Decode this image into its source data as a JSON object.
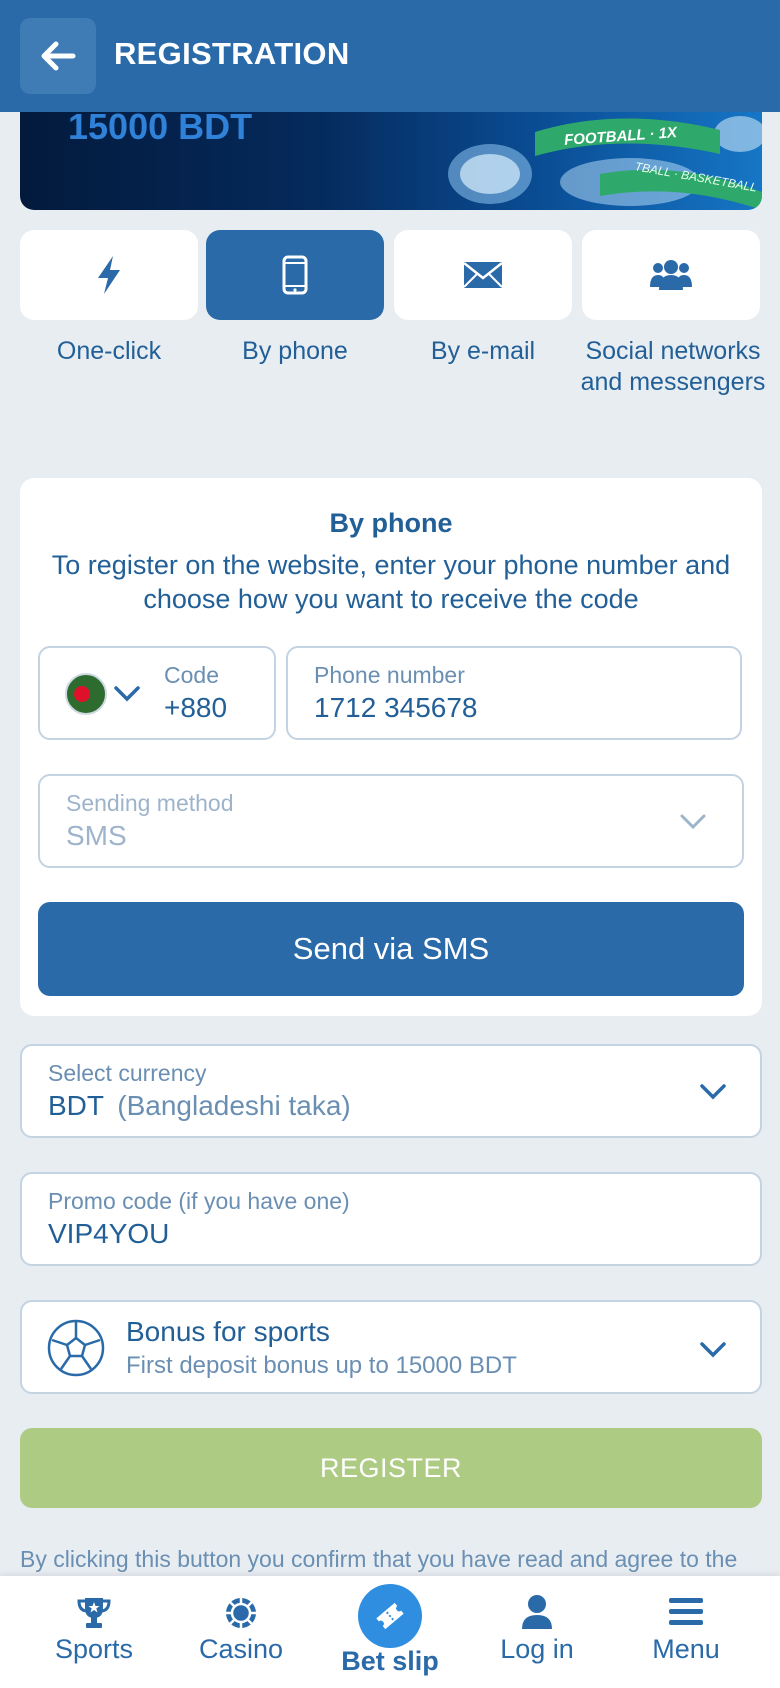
{
  "header": {
    "title": "REGISTRATION",
    "back_icon": "arrow-left-icon"
  },
  "banner": {
    "amount": "15000 BDT",
    "ribbon_text": "FOOTBALL · 1X",
    "ribbon_text_2": "TBALL · BASKETBALL"
  },
  "methods": [
    {
      "label": "One-click",
      "icon": "lightning-icon",
      "active": false
    },
    {
      "label": "By phone",
      "icon": "phone-icon",
      "active": true
    },
    {
      "label": "By e-mail",
      "icon": "envelope-icon",
      "active": false
    },
    {
      "label": "Social networks and messengers",
      "icon": "users-icon",
      "active": false
    }
  ],
  "phone_card": {
    "title": "By phone",
    "description": "To register on the website, enter your phone number and choose how you want to receive the code",
    "code_label": "Code",
    "code_value": "+880",
    "phone_label": "Phone number",
    "phone_value": "1712 345678",
    "sending_label": "Sending method",
    "sending_value": "SMS",
    "send_button": "Send via SMS"
  },
  "currency": {
    "label": "Select currency",
    "code": "BDT",
    "name": "(Bangladeshi taka)"
  },
  "promo": {
    "label": "Promo code (if you have one)",
    "value": "VIP4YOU"
  },
  "bonus": {
    "title": "Bonus for sports",
    "subtitle": "First deposit bonus up to 15000 BDT"
  },
  "register_button": "REGISTER",
  "legal_text": "By clicking this button you confirm that you have read and agree to the",
  "nav": {
    "sports": "Sports",
    "casino": "Casino",
    "betslip": "Bet slip",
    "login": "Log in",
    "menu": "Menu"
  },
  "colors": {
    "primary": "#2a6aa8",
    "register": "#adcb82",
    "background": "#e8edf2"
  }
}
